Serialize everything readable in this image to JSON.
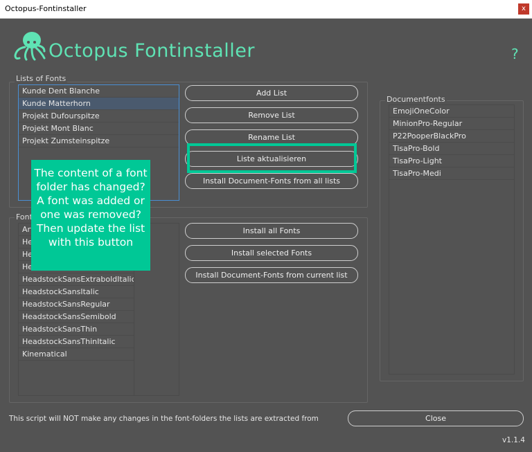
{
  "window": {
    "title": "Octopus-Fontinstaller",
    "close": "x"
  },
  "header": {
    "title": "Octopus Fontinstaller",
    "help": "?"
  },
  "lists": {
    "label": "Lists of Fonts",
    "items": [
      "Kunde Dent Blanche",
      "Kunde Matterhorn",
      "Projekt Dufourspitze",
      "Projekt Mont Blanc",
      "Projekt Zumsteinspitze"
    ],
    "selected": "Kunde Matterhorn"
  },
  "list_buttons": [
    "Add List",
    "Remove List",
    "Rename List",
    "Liste aktualisieren",
    "Install Document-Fonts from all lists"
  ],
  "fonts": {
    "label": "Fonts",
    "items": [
      "Art",
      "He",
      "He",
      "He",
      "HeadstockSansExtraboldItalic",
      "HeadstockSansItalic",
      "HeadstockSansRegular",
      "HeadstockSansSemibold",
      "HeadstockSansThin",
      "HeadstockSansThinItalic",
      "Kinematical"
    ]
  },
  "font_buttons": [
    "Install all Fonts",
    "Install selected Fonts",
    "Install Document-Fonts from current list"
  ],
  "documentfonts": {
    "label": "Documentfonts",
    "items": [
      "EmojiOneColor",
      "MinionPro-Regular",
      "P22PooperBlackPro",
      "TisaPro-Bold",
      "TisaPro-Light",
      "TisaPro-Medi"
    ]
  },
  "tooltip": "The content of a font folder has changed? A font was added or one was removed? Then update the list with this button",
  "footer": {
    "note": "This script will NOT make any changes in the font-folders the lists are extracted from",
    "close": "Close",
    "version": "v1.1.4"
  },
  "colors": {
    "accent": "#00c896",
    "logo": "#5fe3b4",
    "background": "#535353"
  }
}
